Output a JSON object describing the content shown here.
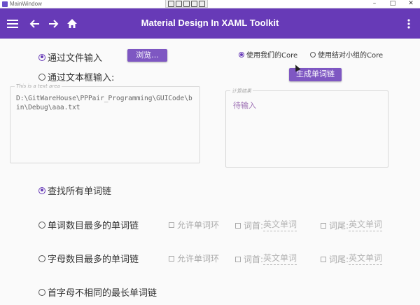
{
  "window": {
    "title": "MainWindow",
    "controls": [
      "–",
      "□",
      "✕"
    ]
  },
  "appbar": {
    "title": "Material Design In XAML Toolkit"
  },
  "input_mode": {
    "file_input_label": "通过文件输入",
    "browse_button": "浏览...",
    "text_input_label": "通过文本框输入:",
    "textarea_hint": "This is a text area",
    "textarea_value": "D:\\GitWareHouse\\PPPair_Programming\\GUICode\\bin\\Debug\\aaa.txt"
  },
  "core": {
    "our_core_label": "使用我们的Core",
    "partner_core_label": "使用结对小组的Core",
    "generate_button": "生成单词链"
  },
  "result": {
    "hint": "计算结果",
    "placeholder": "待输入"
  },
  "modes": {
    "all_chains": "查找所有单词链",
    "most_words": "单词数目最多的单词链",
    "most_letters": "字母数目最多的单词链",
    "unique_head": "首字母不相同的最长单词链"
  },
  "options": {
    "allow_loop": "允许单词环",
    "head_label": "词首:",
    "tail_label": "词尾:",
    "word_placeholder": "英文单词"
  },
  "colors": {
    "primary": "#673ab7",
    "accent": "#7e57c2"
  }
}
